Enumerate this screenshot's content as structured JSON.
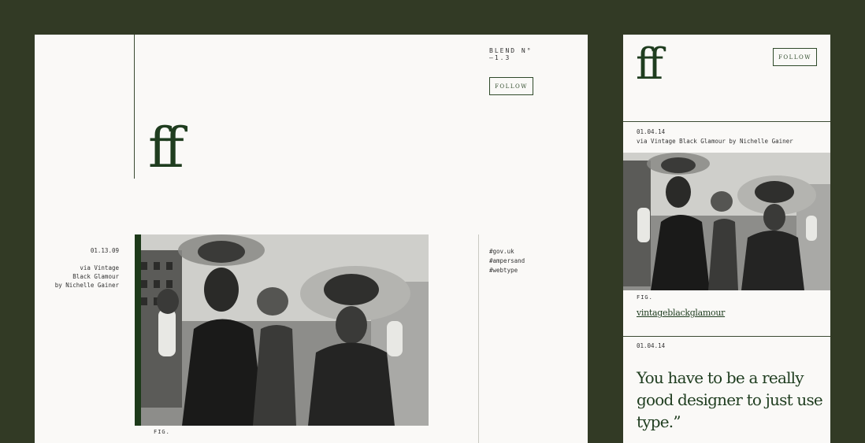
{
  "desktop": {
    "logo": "ff",
    "blend": "BLEND N°\n—1.3",
    "follow_label": "FOLLOW",
    "date": "01.13.09",
    "via": "via Vintage\nBlack Glamour\nby Nichelle Gainer",
    "fig_label": "FIG.",
    "tags": [
      "#gov.uk",
      "#ampersand",
      "#webtype"
    ],
    "accent_color": "#1d3a1a"
  },
  "mobile": {
    "logo": "ff",
    "follow_label": "FOLLOW",
    "date": "01.04.14",
    "via": "via Vintage Black Glamour by Nichelle Gainer",
    "fig_label": "FIG.",
    "link": "vintageblackglamour",
    "date2": "01.04.14",
    "quote": "You have to be a really good designer to just use type.”"
  },
  "colors": {
    "background": "#323a25",
    "card": "#faf9f7",
    "brand_green": "#1f3d1f"
  }
}
